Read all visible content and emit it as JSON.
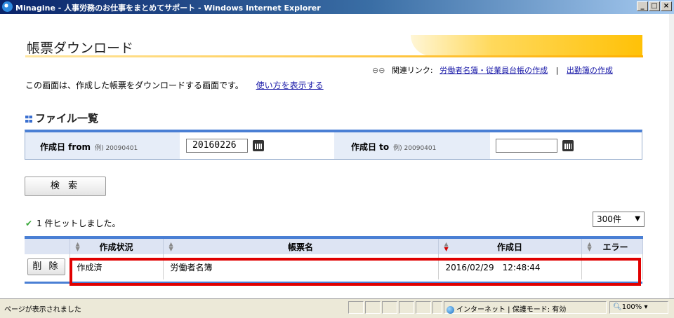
{
  "window": {
    "title": "Minagine - 人事労務のお仕事をまとめてサポート - Windows Internet Explorer",
    "minimize": "_",
    "maximize": "□",
    "close": "×"
  },
  "page": {
    "title": "帳票ダウンロード",
    "related_label": "関連リンク:",
    "related_links": [
      "労働者名簿・従業員台帳の作成",
      "出勤簿の作成"
    ],
    "related_sep": "|",
    "description": "この画面は、作成した帳票をダウンロードする画面です。",
    "help_link": "使い方を表示する",
    "section_title": "ファイル一覧"
  },
  "search": {
    "from_label": "作成日 from",
    "from_example": "例) 20090401",
    "from_value": "20160226",
    "to_label": "作成日 to",
    "to_example": "例) 20090401",
    "to_value": "",
    "button": "検 索"
  },
  "results": {
    "hit_text": "1 件ヒットしました。",
    "per_page": "300件",
    "columns": [
      "",
      "作成状況",
      "帳票名",
      "作成日",
      "エラー"
    ],
    "rows": [
      {
        "action": "削 除",
        "status": "作成済",
        "name": "労働者名簿",
        "date": "2016/02/29　12:48:44",
        "error": ""
      }
    ]
  },
  "statusbar": {
    "text": "ページが表示されました",
    "zone": "インターネット | 保護モード: 有効",
    "zoom": "100%"
  },
  "colors": {
    "accent_blue": "#4a7fd4",
    "highlight_red": "#e00000",
    "header_orange": "#ffc107"
  }
}
